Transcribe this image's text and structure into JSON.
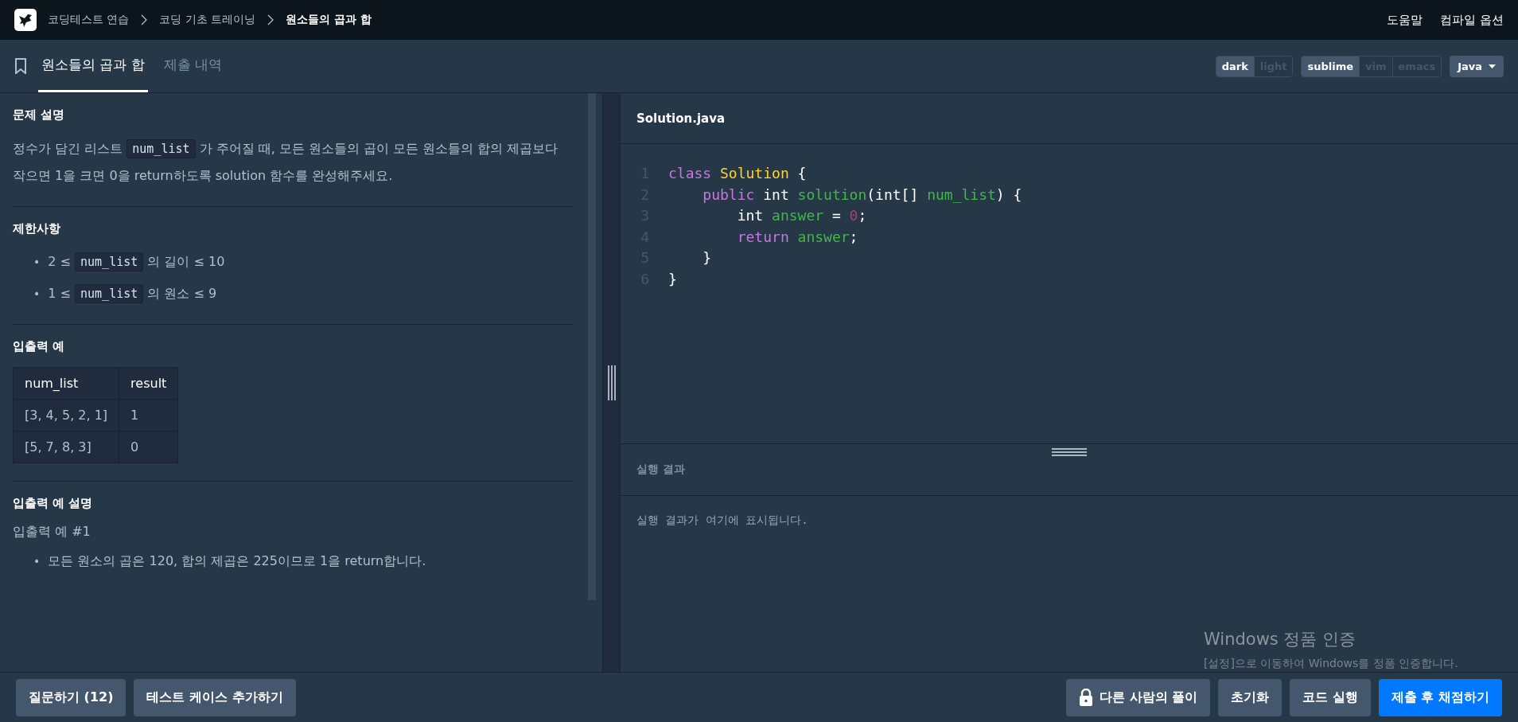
{
  "topbar": {
    "breadcrumbs": [
      {
        "label": "코딩테스트 연습",
        "current": false
      },
      {
        "label": "코딩 기초 트레이닝",
        "current": false
      },
      {
        "label": "원소들의 곱과 합",
        "current": true
      }
    ],
    "links": [
      "도움말",
      "컴파일 옵션"
    ]
  },
  "tabs": [
    {
      "label": "원소들의 곱과 합",
      "selected": true
    },
    {
      "label": "제출 내역",
      "selected": false
    }
  ],
  "toggles": [
    {
      "options": [
        {
          "label": "dark",
          "selected": true
        },
        {
          "label": "light",
          "selected": false
        }
      ]
    },
    {
      "options": [
        {
          "label": "sublime",
          "selected": true
        },
        {
          "label": "vim",
          "selected": false
        },
        {
          "label": "emacs",
          "selected": false
        }
      ]
    }
  ],
  "language": "Java",
  "problem": {
    "sections": [
      {
        "title": "문제 설명",
        "blocks": [
          {
            "kind": "paragraph",
            "parts": [
              {
                "kind": "text",
                "text": "정수가 담긴 리스트 "
              },
              {
                "kind": "code",
                "text": "num_list"
              },
              {
                "kind": "text",
                "text": " 가 주어질 때, 모든 원소들의 곱이 모든 원소들의 합의 제곱보다 작으면 1을 크면 0을 return하도록 solution 함수를 완성해주세요."
              }
            ]
          }
        ]
      },
      {
        "title": "제한사항",
        "blocks": [
          {
            "kind": "bullets",
            "marker": "•",
            "items": [
              [
                {
                  "kind": "text",
                  "text": "2 ≤ "
                },
                {
                  "kind": "code",
                  "text": "num_list"
                },
                {
                  "kind": "text",
                  "text": " 의 길이 ≤ 10"
                }
              ],
              [
                {
                  "kind": "text",
                  "text": "1 ≤ "
                },
                {
                  "kind": "code",
                  "text": "num_list"
                },
                {
                  "kind": "text",
                  "text": " 의 원소 ≤ 9"
                }
              ]
            ]
          }
        ]
      },
      {
        "title": "입출력 예",
        "blocks": [
          {
            "kind": "table",
            "columns": [
              "num_list",
              "result"
            ],
            "rows": [
              [
                "[3, 4, 5, 2, 1]",
                "1"
              ],
              [
                "[5, 7, 8, 3]",
                "0"
              ]
            ]
          }
        ]
      },
      {
        "title": "입출력 예 설명",
        "blocks": [
          {
            "kind": "subheading",
            "text": "입출력 예 #1"
          },
          {
            "kind": "bullets",
            "marker": "•",
            "items": [
              [
                {
                  "kind": "text",
                  "text": "모든 원소의 곱은 120, 합의 제곱은 225이므로 1을 return합니다."
                }
              ]
            ]
          }
        ]
      }
    ]
  },
  "editor": {
    "filename": "Solution.java",
    "lines": [
      {
        "number": "1",
        "tokens": [
          {
            "kind": "keyword",
            "text": "class"
          },
          {
            "kind": "type",
            "text": " Solution"
          },
          {
            "kind": "plain",
            "text": " {"
          }
        ]
      },
      {
        "number": "2",
        "tokens": [
          {
            "kind": "keyword",
            "text": "    public"
          },
          {
            "kind": "plain",
            "text": " int "
          },
          {
            "kind": "name",
            "text": "solution"
          },
          {
            "kind": "plain",
            "text": "(int[] "
          },
          {
            "kind": "name",
            "text": "num_list"
          },
          {
            "kind": "plain",
            "text": ") {"
          }
        ]
      },
      {
        "number": "3",
        "tokens": [
          {
            "kind": "plain",
            "text": "        int "
          },
          {
            "kind": "name",
            "text": "answer"
          },
          {
            "kind": "plain",
            "text": " = "
          },
          {
            "kind": "number",
            "text": "0"
          },
          {
            "kind": "plain",
            "text": ";"
          }
        ]
      },
      {
        "number": "4",
        "tokens": [
          {
            "kind": "keyword",
            "text": "        return"
          },
          {
            "kind": "name",
            "text": " answer"
          },
          {
            "kind": "plain",
            "text": ";"
          }
        ]
      },
      {
        "number": "5",
        "tokens": [
          {
            "kind": "plain",
            "text": "    }"
          }
        ]
      },
      {
        "number": "6",
        "tokens": [
          {
            "kind": "plain",
            "text": "}"
          }
        ]
      }
    ]
  },
  "result": {
    "title": "실행 결과",
    "message": "실행 결과가 여기에 표시됩니다."
  },
  "footer": {
    "left_buttons": [
      "질문하기 (12)",
      "테스트 케이스 추가하기"
    ],
    "right_buttons": [
      {
        "label": "다른 사람의 풀이",
        "kind": "locked"
      },
      {
        "label": "초기화",
        "kind": "secondary"
      },
      {
        "label": "코드 실행",
        "kind": "secondary"
      },
      {
        "label": "제출 후 채점하기",
        "kind": "primary"
      }
    ]
  },
  "os_notice": {
    "title": "Windows 정품 인증",
    "text": "[설정]으로 이동하여 Windows를 정품 인증합니다."
  }
}
